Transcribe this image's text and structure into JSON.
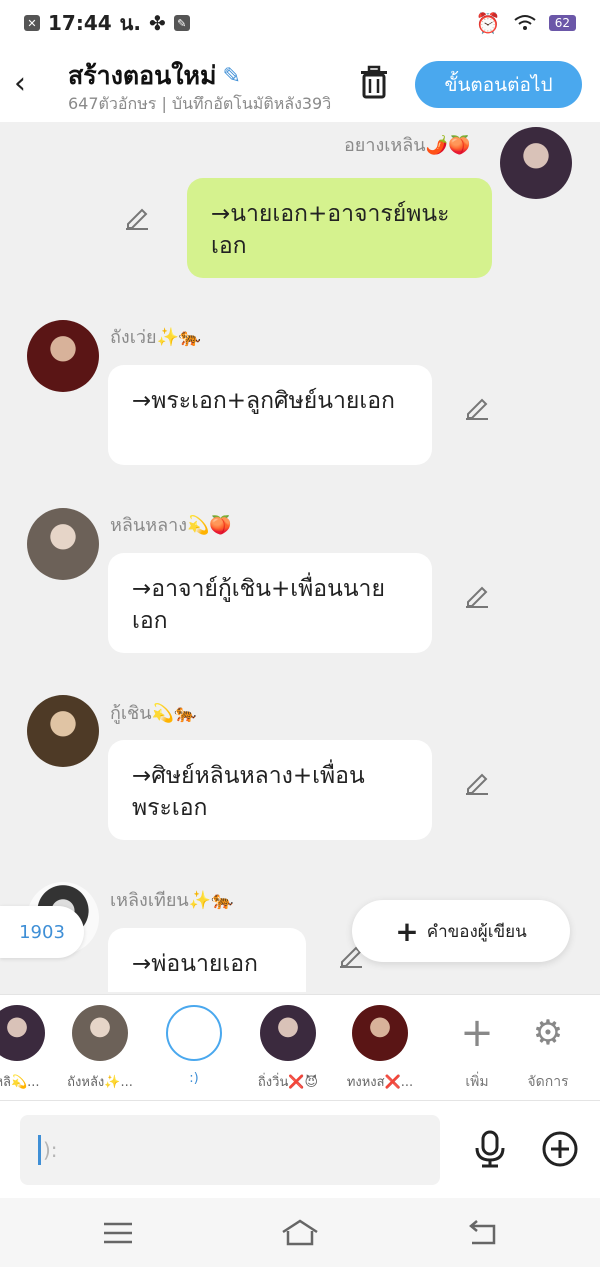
{
  "status_bar": {
    "time": "17:44",
    "carrier": "น.",
    "battery": "62"
  },
  "header": {
    "title": "สร้างตอนใหม่",
    "subtitle": "647ตัวอักษร | บันทึกอัตโนมัติหลัง39วิ",
    "next_label": "ขั้นตอนต่อไป"
  },
  "messages": [
    {
      "name": "อยางเหลิน🌶️🍑",
      "text": "→นายเอก+อาจารย์พนะเอก"
    },
    {
      "name": "ถังเว่ย✨🐅",
      "text": "→พระเอก+ลูกศิษย์นายเอก"
    },
    {
      "name": "หลินหลาง💫🍑",
      "text": "→อาจาย์กู้เชิน+เพื่อนนายเอก"
    },
    {
      "name": "กู้เชิน💫🐅",
      "text": "→ศิษย์หลินหลาง+เพื่อนพระเอก"
    },
    {
      "name": "เหลิงเทียน✨🐅",
      "text": "→พ่อนายเอก"
    }
  ],
  "badge_count": "1903",
  "author_button": "คำของผู้เขียน",
  "characters": [
    {
      "name": "หลิ💫..."
    },
    {
      "name": "ถังหลัง✨..."
    },
    {
      "name": ":)"
    },
    {
      "name": "ถิ่งวิ่น❌😈"
    },
    {
      "name": "ทงหงส❌..."
    }
  ],
  "tools": {
    "add_label": "เพิ่ม",
    "manage_label": "จัดการ"
  },
  "input": {
    "placeholder": "):"
  }
}
